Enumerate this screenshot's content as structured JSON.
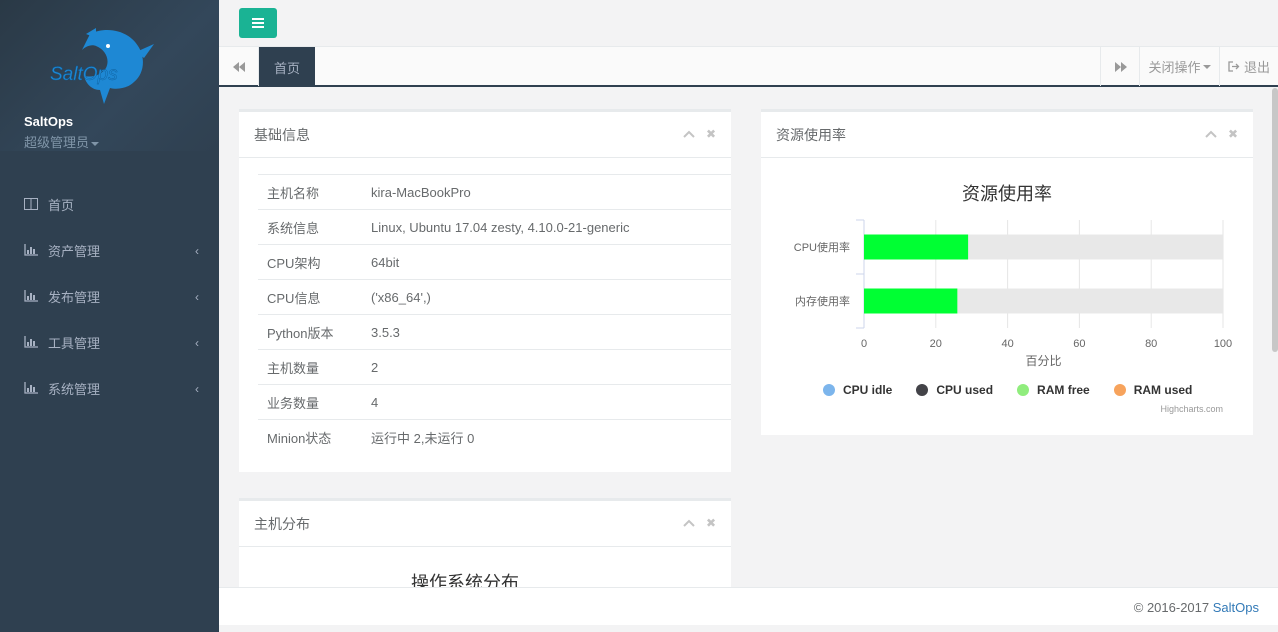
{
  "sidebar": {
    "logo_text": "SaltOps",
    "user_name": "SaltOps",
    "user_role": "超级管理员",
    "items": [
      {
        "label": "首页",
        "icon": "columns-icon",
        "has_children": false
      },
      {
        "label": "资产管理",
        "icon": "bar-chart-icon",
        "has_children": true
      },
      {
        "label": "发布管理",
        "icon": "bar-chart-icon",
        "has_children": true
      },
      {
        "label": "工具管理",
        "icon": "bar-chart-icon",
        "has_children": true
      },
      {
        "label": "系统管理",
        "icon": "bar-chart-icon",
        "has_children": true
      }
    ]
  },
  "tabs": {
    "active": "首页",
    "close_ops": "关闭操作",
    "logout": "退出"
  },
  "basic_info": {
    "title": "基础信息",
    "rows": [
      {
        "key": "主机名称",
        "value": "kira-MacBookPro"
      },
      {
        "key": "系统信息",
        "value": "Linux, Ubuntu 17.04 zesty, 4.10.0-21-generic"
      },
      {
        "key": "CPU架构",
        "value": "64bit"
      },
      {
        "key": "CPU信息",
        "value": "('x86_64',)"
      },
      {
        "key": "Python版本",
        "value": "3.5.3"
      },
      {
        "key": "主机数量",
        "value": "2"
      },
      {
        "key": "业务数量",
        "value": "4"
      },
      {
        "key": "Minion状态",
        "value": "运行中 2,未运行 0"
      }
    ]
  },
  "resource": {
    "title": "资源使用率",
    "credits": "Highcharts.com"
  },
  "host_dist": {
    "title": "主机分布",
    "chart_title": "操作系统分布"
  },
  "chart_data": {
    "type": "bar",
    "title": "资源使用率",
    "xlabel": "百分比",
    "categories": [
      "CPU使用率",
      "内存使用率"
    ],
    "series": [
      {
        "name": "CPU idle",
        "color": "#7cb5ec"
      },
      {
        "name": "CPU used",
        "color": "#434348"
      },
      {
        "name": "RAM free",
        "color": "#90ed7d"
      },
      {
        "name": "RAM used",
        "color": "#f7a35c"
      }
    ],
    "values": [
      29,
      26
    ],
    "bar_color": "#00ff33",
    "track_color": "#e8e8e8",
    "xlim": [
      0,
      100
    ],
    "ticks": [
      0,
      20,
      40,
      60,
      80,
      100
    ]
  },
  "footer": {
    "copyright": "© 2016-2017 ",
    "brand": "SaltOps"
  }
}
